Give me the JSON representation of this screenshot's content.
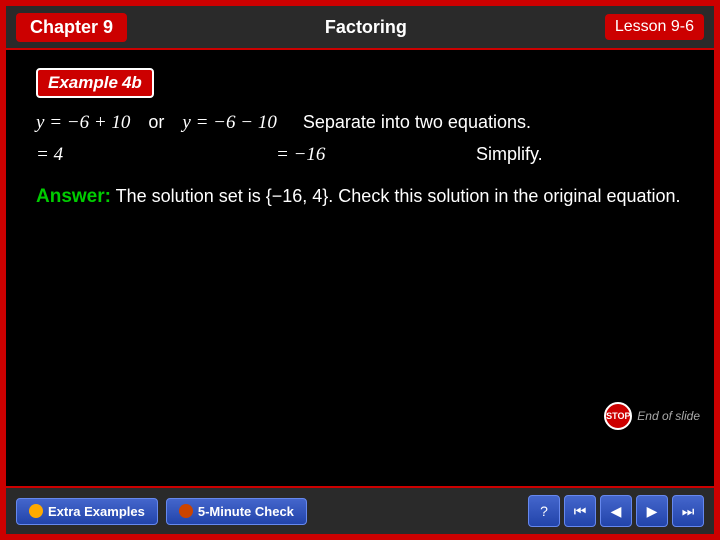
{
  "header": {
    "chapter_label": "Chapter 9",
    "title": "Factoring",
    "lesson_label": "Lesson 9-6"
  },
  "example": {
    "badge": "Example 4b"
  },
  "math": {
    "eq1_lhs": "y = −6 + 10",
    "or_label": "or",
    "eq1_rhs": "y = −6 − 10",
    "separate_label": "Separate into two equations.",
    "simp1": "= 4",
    "simp2": "= −16",
    "simplify_label": "Simplify.",
    "answer_label": "Answer:",
    "answer_text": "The solution set is {−16, 4}. Check this solution in the original equation."
  },
  "footer": {
    "btn1_label": "Extra Examples",
    "btn2_label": "5-Minute Check"
  },
  "end_of_slide": "End of slide",
  "icons": {
    "question": "?",
    "prev_prev": "⏮",
    "prev": "◀",
    "next": "▶",
    "next_next": "⏭"
  }
}
